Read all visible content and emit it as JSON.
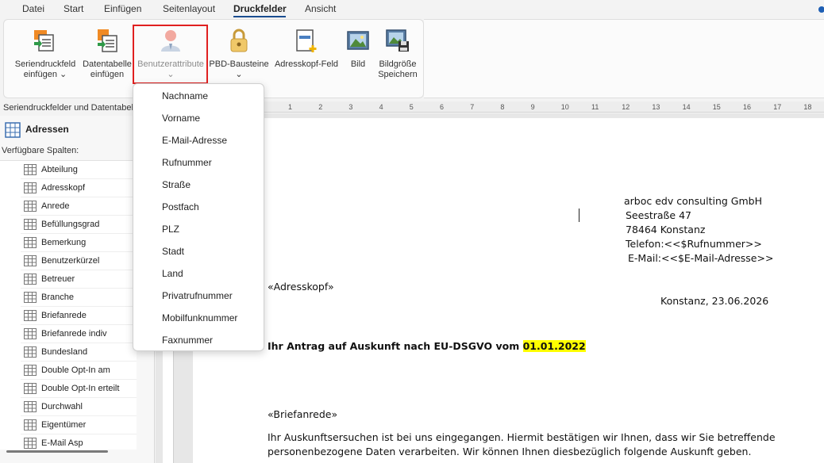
{
  "menu": {
    "tabs": [
      "Datei",
      "Start",
      "Einfügen",
      "Seitenlayout",
      "Druckfelder",
      "Ansicht"
    ],
    "active_tab": "Druckfelder"
  },
  "ribbon": {
    "buttons": [
      {
        "line1": "Seriendruckfeld",
        "line2": "einfügen ⌄"
      },
      {
        "line1": "Datentabelle",
        "line2": "einfügen"
      },
      {
        "line1": "Benutzerattribute",
        "line2": "⌄"
      },
      {
        "line1": "PBD-Bausteine",
        "line2": "⌄"
      },
      {
        "line1": "Adresskopf-Feld",
        "line2": ""
      },
      {
        "line1": "Bild",
        "line2": ""
      },
      {
        "line1": "Bildgröße",
        "line2": "Speichern"
      }
    ]
  },
  "panel": {
    "title": "Seriendruckfelder und Datentabelle",
    "header": "Adressen",
    "subheader": "Verfügbare Spalten:",
    "columns": [
      "Abteilung",
      "Adresskopf",
      "Anrede",
      "Befüllungsgrad",
      "Bemerkung",
      "Benutzerkürzel",
      "Betreuer",
      "Branche",
      "Briefanrede",
      "Briefanrede indiv",
      "Bundesland",
      "Double Opt-In am",
      "Double Opt-In erteilt",
      "Durchwahl",
      "Eigentümer",
      "E-Mail Asp"
    ]
  },
  "dropdown": {
    "items": [
      "Nachname",
      "Vorname",
      "E-Mail-Adresse",
      "Rufnummer",
      "Straße",
      "Postfach",
      "PLZ",
      "Stadt",
      "Land",
      "Privatrufnummer",
      "Mobilfunknummer",
      "Faxnummer"
    ]
  },
  "ruler": {
    "ticks": [
      "1",
      "2",
      "3",
      "4",
      "5",
      "6",
      "7",
      "8",
      "9",
      "10",
      "11",
      "12",
      "13",
      "14",
      "15",
      "16",
      "17",
      "18"
    ]
  },
  "document": {
    "sender": {
      "company": "arboc edv consulting GmbH",
      "street": "Seestraße 47",
      "city": "78464 Konstanz",
      "phone": "Telefon:<<$Rufnummer>>",
      "email": "E-Mail:<<$E-Mail-Adresse>>"
    },
    "address_field": "«Adresskopf»",
    "date": "Konstanz, 23.06.2026",
    "subject": "Ihr Antrag auf Auskunft nach EU-DSGVO vom ",
    "subject_date": "01.01.2022",
    "salutation": "«Briefanrede»",
    "body_line1": "Ihr Auskunftsersuchen ist bei uns eingegangen. Hiermit bestätigen wir Ihnen, dass wir Sie betreffende",
    "body_line2": "personenbezogene Daten verarbeiten. Wir können Ihnen diesbezüglich folgende Auskunft geben."
  },
  "colors": {
    "accent": "#1a4d8f",
    "highlight_border": "#e02020",
    "text_highlight": "#ffff00"
  }
}
